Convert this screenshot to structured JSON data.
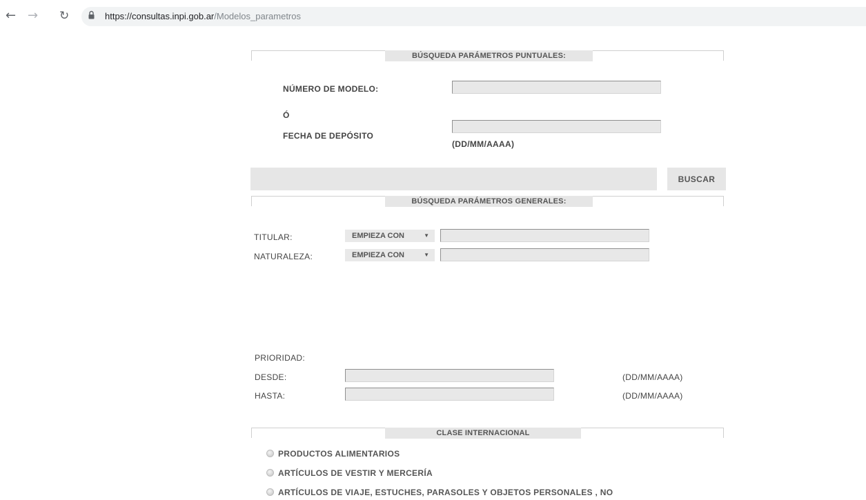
{
  "browser": {
    "url_host": "https://consultas.inpi.gob.ar",
    "url_path": "/Modelos_parametros"
  },
  "puntuales": {
    "title": "BÚSQUEDA PARÁMETROS PUNTUALES:",
    "numero_label": "NÚMERO DE MODELO:",
    "numero_value": "",
    "o_label": "Ó",
    "fecha_label": "FECHA DE DEPÓSITO",
    "fecha_value": "",
    "fecha_hint": "(DD/MM/AAAA)",
    "search_button": "BUSCAR"
  },
  "generales": {
    "title": "BÚSQUEDA PARÁMETROS GENERALES:",
    "titular_label": "TITULAR:",
    "titular_operator": "EMPIEZA CON",
    "titular_value": "",
    "naturaleza_label": "NATURALEZA:",
    "naturaleza_operator": "EMPIEZA CON",
    "naturaleza_value": ""
  },
  "prioridad": {
    "label": "PRIORIDAD:",
    "desde_label": "DESDE:",
    "desde_value": "",
    "desde_hint": "(DD/MM/AAAA)",
    "hasta_label": "HASTA:",
    "hasta_value": "",
    "hasta_hint": "(DD/MM/AAAA)"
  },
  "clase": {
    "title": "CLASE INTERNACIONAL",
    "options": [
      "PRODUCTOS ALIMENTARIOS",
      "ARTÍCULOS DE VESTIR Y MERCERÍA",
      "ARTÍCULOS DE VIAJE, ESTUCHES, PARASOLES Y OBJETOS PERSONALES , NO"
    ]
  }
}
